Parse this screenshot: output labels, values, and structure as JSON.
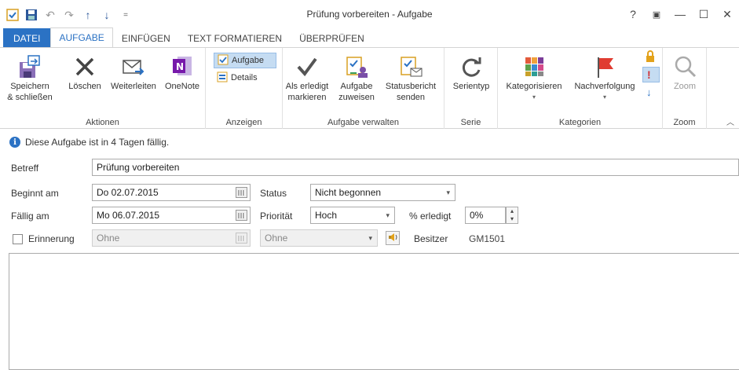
{
  "window": {
    "title": "Prüfung vorbereiten - Aufgabe",
    "controls": [
      "?",
      "▣",
      "—",
      "☐",
      "✕"
    ]
  },
  "qat": {
    "undo": "↶",
    "redo": "↷",
    "up": "↑",
    "down": "↓",
    "more": "="
  },
  "tabs": [
    "DATEI",
    "AUFGABE",
    "EINFÜGEN",
    "TEXT FORMATIEREN",
    "ÜBERPRÜFEN"
  ],
  "ribbon": {
    "aktionen": {
      "label": "Aktionen",
      "save_line1": "Speichern",
      "save_line2": "& schließen",
      "delete": "Löschen",
      "forward": "Weiterleiten",
      "onenote": "OneNote"
    },
    "anzeigen": {
      "label": "Anzeigen",
      "task": "Aufgabe",
      "details": "Details"
    },
    "verwalten": {
      "label": "Aufgabe verwalten",
      "done_line1": "Als erledigt",
      "done_line2": "markieren",
      "assign_line1": "Aufgabe",
      "assign_line2": "zuweisen",
      "report_line1": "Statusbericht",
      "report_line2": "senden"
    },
    "serie": {
      "label": "Serie",
      "recurrence": "Serientyp"
    },
    "kategorien": {
      "label": "Kategorien",
      "categorize": "Kategorisieren",
      "followup": "Nachverfolgung"
    },
    "zoom": {
      "label": "Zoom",
      "zoom": "Zoom"
    }
  },
  "info": {
    "text": "Diese Aufgabe ist in 4 Tagen fällig."
  },
  "form": {
    "subject_label": "Betreff",
    "subject_value": "Prüfung vorbereiten",
    "start_label": "Beginnt am",
    "start_value": "Do 02.07.2015",
    "due_label": "Fällig am",
    "due_value": "Mo 06.07.2015",
    "reminder_label": "Erinnerung",
    "reminder_date": "Ohne",
    "reminder_time": "Ohne",
    "status_label": "Status",
    "status_value": "Nicht begonnen",
    "priority_label": "Priorität",
    "priority_value": "Hoch",
    "percent_label": "% erledigt",
    "percent_value": "0%",
    "owner_label": "Besitzer",
    "owner_value": "GM1501"
  },
  "colors": {
    "accent": "#2b72c4",
    "flag": "#e03c31"
  }
}
